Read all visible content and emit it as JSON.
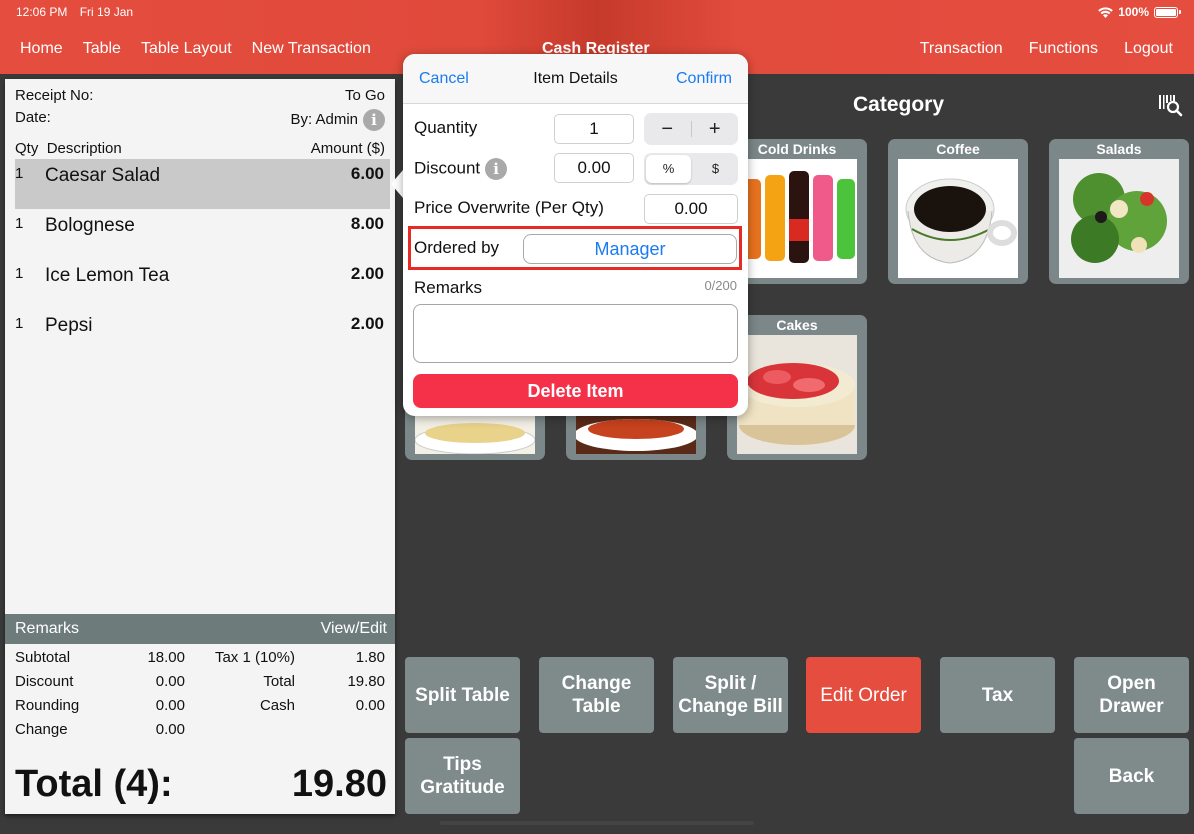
{
  "status_bar": {
    "time": "12:06 PM",
    "date": "Fri 19 Jan",
    "battery": "100%",
    "battery_level": 1.0
  },
  "nav": {
    "left": [
      "Home",
      "Table",
      "Table Layout",
      "New Transaction"
    ],
    "title": "Cash Register",
    "right": [
      "Transaction",
      "Functions",
      "Logout"
    ]
  },
  "receipt": {
    "receipt_no_label": "Receipt No:",
    "order_type": "To Go",
    "date_label": "Date:",
    "by": "By: Admin",
    "col_qty": "Qty",
    "col_desc": "Description",
    "col_amount": "Amount ($)",
    "items": [
      {
        "qty": "1",
        "desc": "Caesar Salad",
        "amount": "6.00",
        "selected": true
      },
      {
        "qty": "1",
        "desc": "Bolognese",
        "amount": "8.00"
      },
      {
        "qty": "1",
        "desc": "Ice Lemon Tea",
        "amount": "2.00"
      },
      {
        "qty": "1",
        "desc": "Pepsi",
        "amount": "2.00"
      }
    ],
    "remarks_label": "Remarks",
    "view_edit": "View/Edit",
    "totals": {
      "subtotal_label": "Subtotal",
      "subtotal": "18.00",
      "tax_label": "Tax 1 (10%)",
      "tax": "1.80",
      "discount_label": "Discount",
      "discount": "0.00",
      "total_label": "Total",
      "total": "19.80",
      "rounding_label": "Rounding",
      "rounding": "0.00",
      "cash_label": "Cash",
      "cash": "0.00",
      "change_label": "Change",
      "change": "0.00"
    },
    "grand_label": "Total (4):",
    "grand_total": "19.80"
  },
  "category": {
    "title": "Category",
    "tiles": [
      "Cold Drinks",
      "Coffee",
      "Salads",
      "Cakes"
    ]
  },
  "popup": {
    "cancel": "Cancel",
    "title": "Item Details",
    "confirm": "Confirm",
    "quantity_label": "Quantity",
    "quantity": "1",
    "minus": "−",
    "plus": "+",
    "discount_label": "Discount",
    "discount": "0.00",
    "pct": "%",
    "dollar": "$",
    "price_overwrite_label": "Price Overwrite (Per Qty)",
    "price_overwrite": "0.00",
    "ordered_by_label": "Ordered by",
    "ordered_by": "Manager",
    "remarks_label": "Remarks",
    "remarks_counter": "0/200",
    "remarks_value": "",
    "delete": "Delete Item"
  },
  "actions": [
    "Split Table",
    "Change\nTable",
    "Split /\nChange Bill",
    "Edit Order",
    "Tax",
    "Open\nDrawer",
    "Tips\nGratitude",
    "Back"
  ],
  "colors": {
    "brand_red": "#e54d3e",
    "link_blue": "#1a7cf0",
    "delete_red": "#f5314a",
    "button_gray": "#7f8a8a",
    "highlight": "#e82a27"
  }
}
